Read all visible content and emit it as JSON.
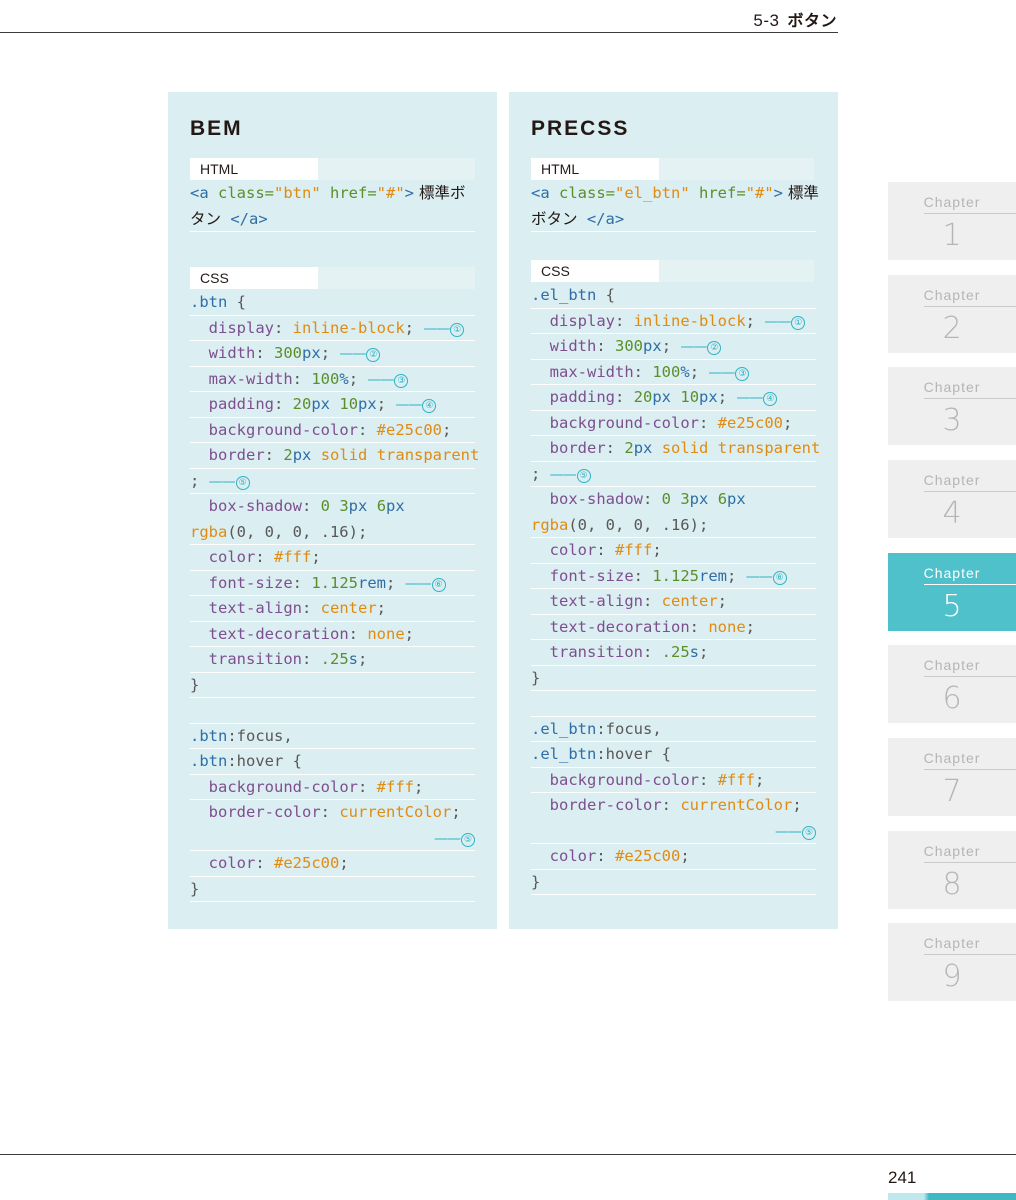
{
  "header": {
    "section_number": "5-3",
    "section_title": "ボタン"
  },
  "left_panel": {
    "title": "BEM",
    "html_label": "HTML",
    "css_label": "CSS",
    "html_code": {
      "tag_open": "<a",
      "attr1": " class=",
      "val1": "\"btn\"",
      "attr2": " href=",
      "val2": "\"#\"",
      "gt": ">",
      "text1": " 標準ボ",
      "text2": "タン",
      "tag_close": " </a>"
    },
    "css": {
      "sel": ".btn",
      "open": " {",
      "display_prop": "display",
      "display_val": "inline-block",
      "width_prop": "width",
      "width_num": "300",
      "width_unit": "px",
      "maxw_prop": "max-width",
      "maxw_num": "100",
      "maxw_unit": "%",
      "padding_prop": "padding",
      "padding_num1": "20",
      "padding_unit1": "px",
      "padding_num2": "10",
      "padding_unit2": "px",
      "bg_prop": "background-color",
      "bg_val": "#e25c00",
      "border_prop": "border",
      "border_num": "2",
      "border_unit": "px",
      "border_val": "solid transparent",
      "shadow_prop": "box-shadow",
      "shadow_nums": "0 3",
      "shadow_unit": "px",
      "shadow_num2": "6",
      "shadow_unit2": "px",
      "rgba_fn": "rgba",
      "rgba_args": "(0, 0, 0, .16);",
      "color_prop": "color",
      "color_val": "#fff",
      "fs_prop": "font-size",
      "fs_num": "1.125",
      "fs_unit": "rem",
      "ta_prop": "text-align",
      "ta_val": "center",
      "td_prop": "text-decoration",
      "td_val": "none",
      "tr_prop": "transition",
      "tr_num": ".25",
      "tr_unit": "s",
      "close": "}",
      "sel_focus": ".btn",
      "pseudo_focus": ":focus,",
      "sel_hover": ".btn",
      "pseudo_hover": ":hover {",
      "h_bg_prop": "background-color",
      "h_bg_val": "#fff",
      "h_bc_prop": "border-color",
      "h_bc_val": "currentColor",
      "h_color_prop": "color",
      "h_color_val": "#e25c00",
      "close2": "}"
    }
  },
  "right_panel": {
    "title": "PRECSS",
    "html_label": "HTML",
    "css_label": "CSS",
    "html_code": {
      "tag_open": "<a",
      "attr1": " class=",
      "val1": "\"el_btn\"",
      "attr2": " href=",
      "val2": "\"#\"",
      "gt": ">",
      "text1": " 標準",
      "text2": "ボタン",
      "tag_close": " </a>"
    },
    "css": {
      "sel": ".el_btn",
      "sel_focus": ".el_btn",
      "sel_hover": ".el_btn"
    }
  },
  "markers": {
    "m1": "①",
    "m2": "②",
    "m3": "③",
    "m4": "④",
    "m5": "⑤",
    "m6": "⑥",
    "dash": "——"
  },
  "chapters": [
    {
      "label": "Chapter",
      "number": "1"
    },
    {
      "label": "Chapter",
      "number": "2"
    },
    {
      "label": "Chapter",
      "number": "3"
    },
    {
      "label": "Chapter",
      "number": "4"
    },
    {
      "label": "Chapter",
      "number": "5",
      "active": true
    },
    {
      "label": "Chapter",
      "number": "6"
    },
    {
      "label": "Chapter",
      "number": "7"
    },
    {
      "label": "Chapter",
      "number": "8"
    },
    {
      "label": "Chapter",
      "number": "9"
    }
  ],
  "footer": {
    "page_number": "241"
  },
  "colors": {
    "panel_bg": "#dbeef1",
    "accent": "#4fc1cb",
    "selector": "#2e6ea6",
    "property": "#7e4f8f",
    "value": "#e08b12",
    "number": "#5a8f2a"
  }
}
